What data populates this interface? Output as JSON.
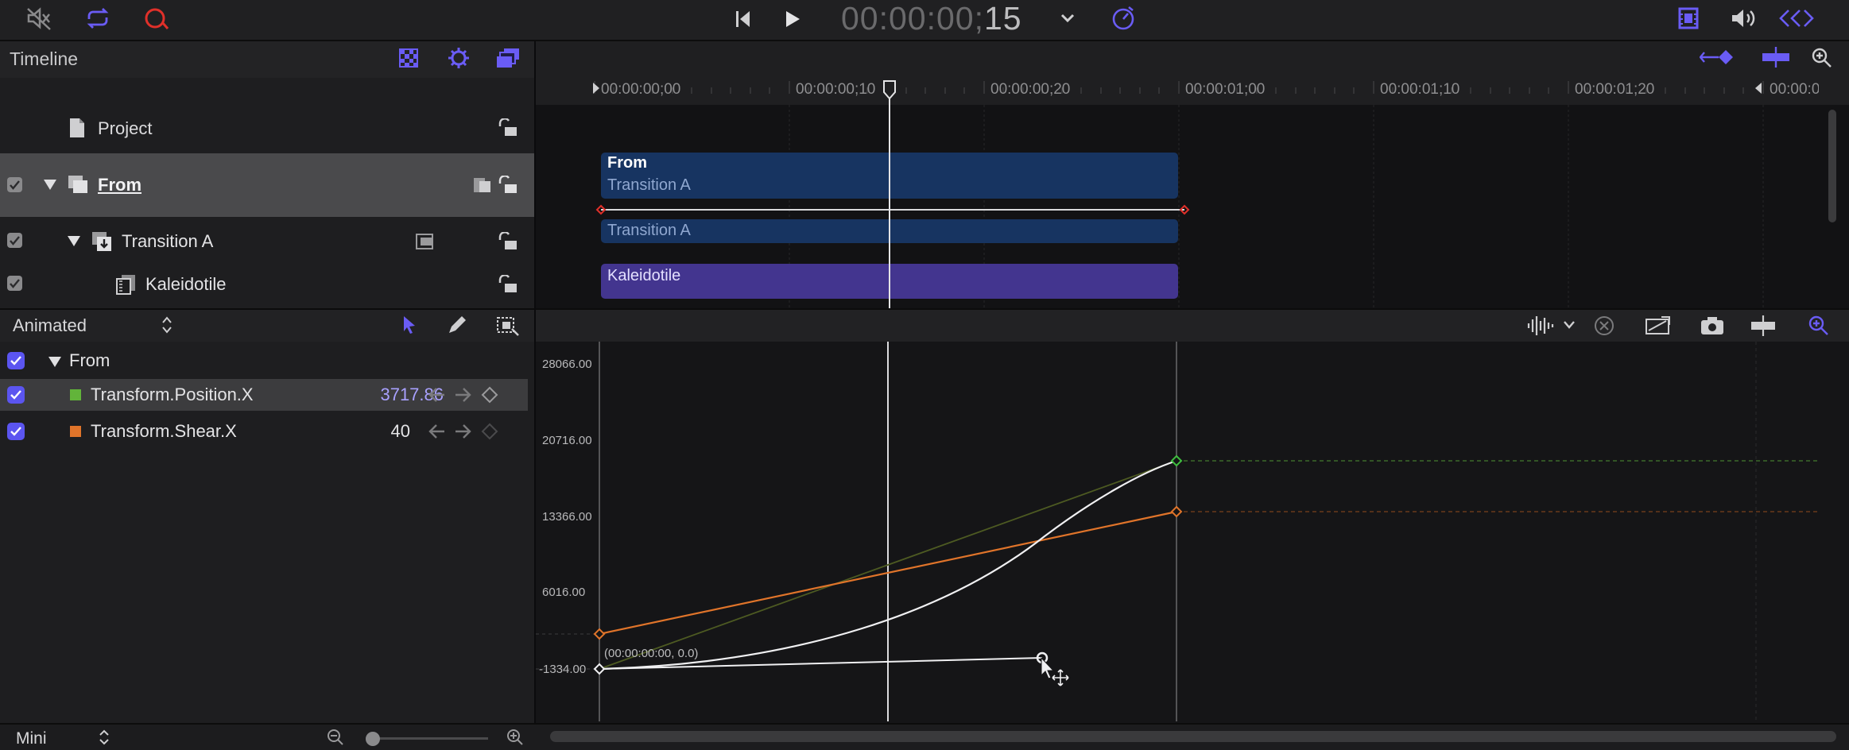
{
  "toolbar": {
    "timecode_main": "00:00:00;",
    "timecode_frames": "15",
    "icons": [
      "mute-icon",
      "loop-icon",
      "record-icon",
      "skip-back-icon",
      "play-icon",
      "timecode-menu-icon",
      "speed-icon",
      "filmstrip-icon",
      "volume-icon",
      "keyframe-nav-icon"
    ]
  },
  "timeline": {
    "title": "Timeline",
    "ruler_labels": [
      "00:00:00;00",
      "00:00:00;10",
      "00:00:00;20",
      "00:00:01;00",
      "00:00:01;10",
      "00:00:01;20",
      "00:00:0"
    ],
    "layers": [
      {
        "name": "Project"
      },
      {
        "name": "From"
      },
      {
        "name": "Transition A"
      },
      {
        "name": "Kaleidotile"
      }
    ],
    "clips": {
      "from_title": "From",
      "from_sub": "Transition A",
      "transition": "Transition A",
      "kaleidotile": "Kaleidotile"
    }
  },
  "params": {
    "filter_label": "Animated",
    "group_name": "From",
    "rows": [
      {
        "name": "Transform.Position.X",
        "value": "3717.86",
        "color": "#62b43a"
      },
      {
        "name": "Transform.Shear.X",
        "value": "40",
        "color": "#e0742a"
      }
    ]
  },
  "graph": {
    "y_labels": [
      "28066.00",
      "20716.00",
      "13366.00",
      "6016.00",
      "-1334.00"
    ],
    "point_readout": "(00:00:00:00, 0.0)"
  },
  "bottom": {
    "zoom_label": "Mini"
  },
  "colors": {
    "accent": "#5b55f0",
    "clip_blue": "#173461",
    "clip_purple": "#43358f",
    "record_red": "#e0302a",
    "curve_green": "#3fbf3f",
    "curve_orange": "#e0742a"
  }
}
